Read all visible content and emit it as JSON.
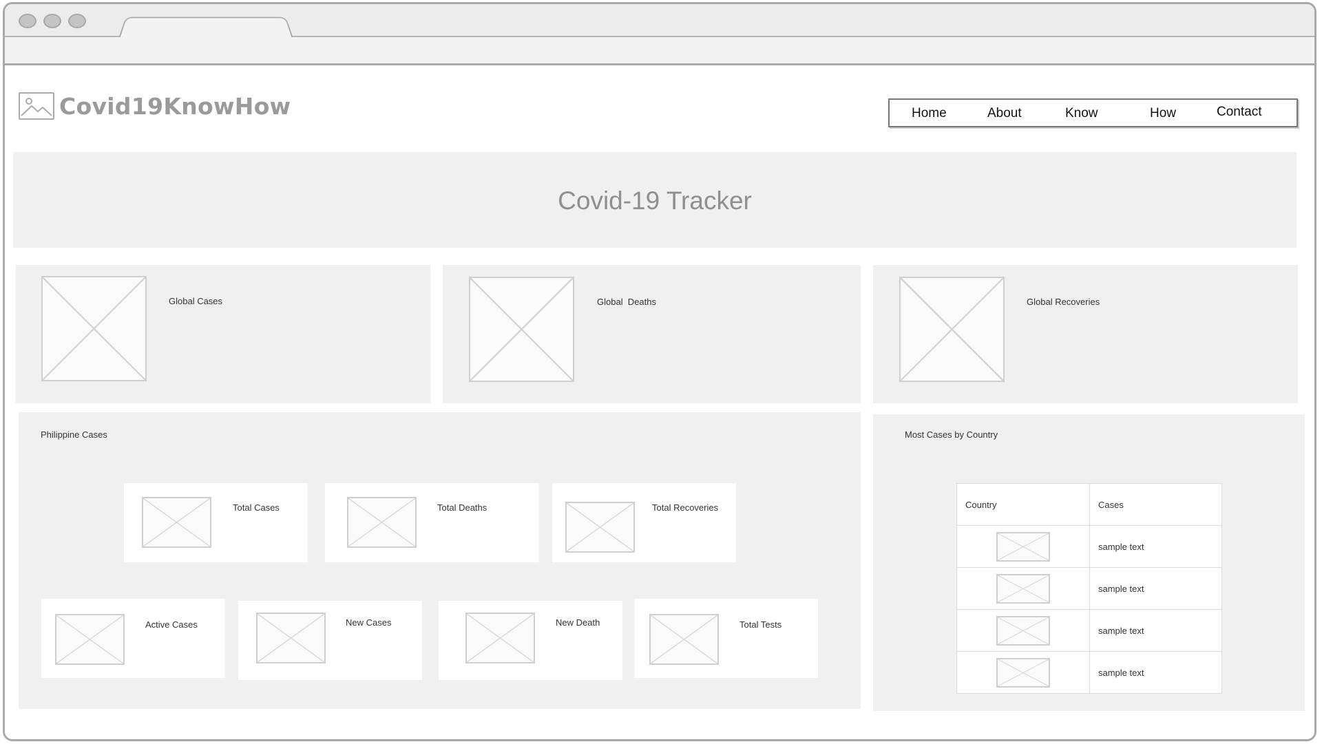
{
  "brand": {
    "name": "Covid19KnowHow"
  },
  "nav": {
    "items": [
      "Home",
      "About",
      "Know",
      "How",
      "Contact"
    ]
  },
  "hero": {
    "title": "Covid-19 Tracker"
  },
  "global": {
    "cases_label": "Global Cases",
    "deaths_label": "Global  Deaths",
    "recoveries_label": "Global Recoveries"
  },
  "philippines": {
    "title": "Philippine Cases",
    "total_cases": "Total Cases",
    "total_deaths": "Total Deaths",
    "total_recoveries": "Total Recoveries",
    "active_cases": "Active Cases",
    "new_cases": "New Cases",
    "new_death": "New Death",
    "total_tests": "Total Tests"
  },
  "countries": {
    "title": "Most Cases by Country",
    "headers": [
      "Country",
      "Cases"
    ],
    "rows": [
      "sample text",
      "sample text",
      "sample text",
      "sample text"
    ]
  },
  "colors": {
    "panel": "#f0f0f0",
    "frame": "#a9a9a9",
    "brand_text": "#9a9a9a"
  }
}
